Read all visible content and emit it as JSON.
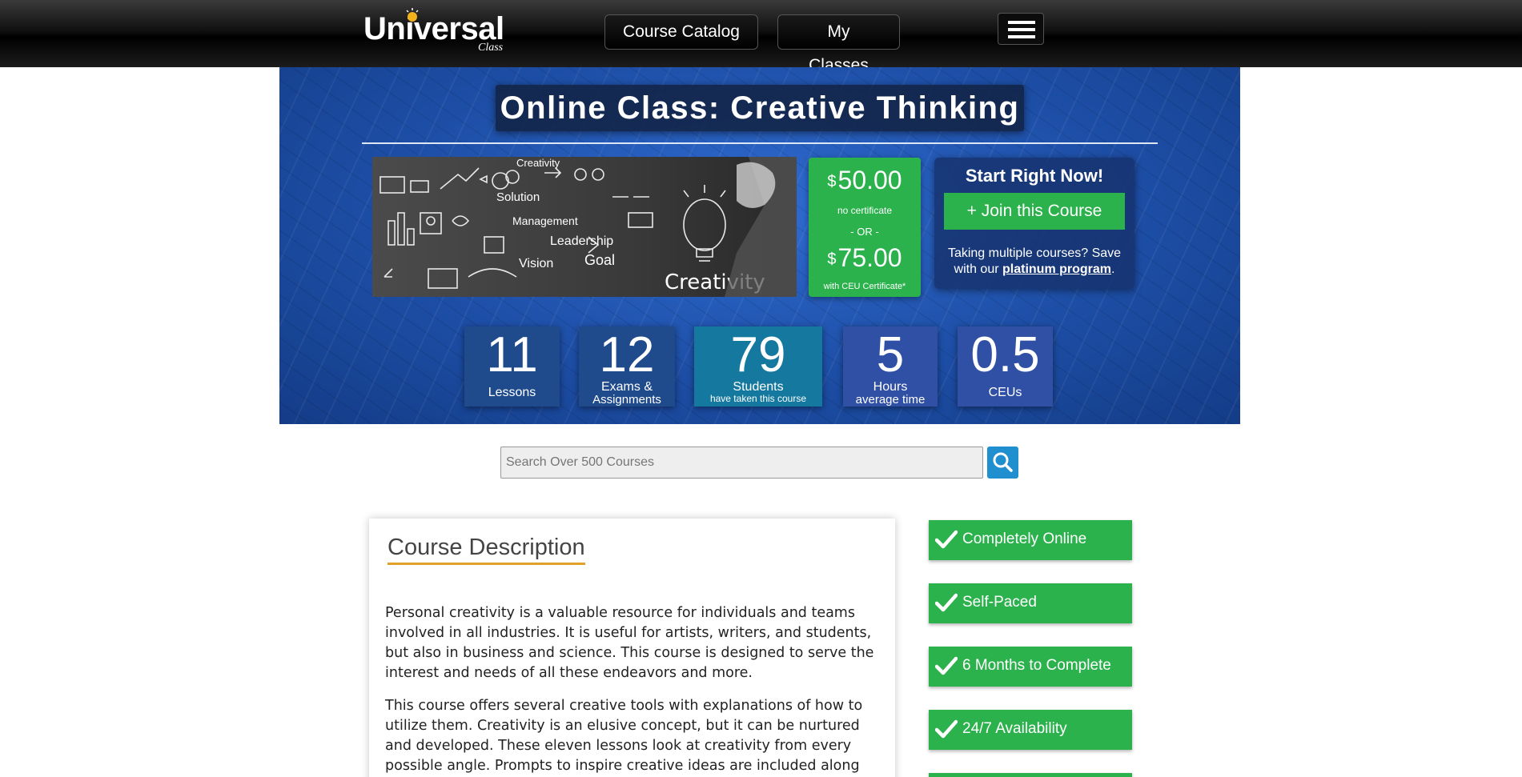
{
  "header": {
    "logo_main": "Universal",
    "logo_sub": "Class",
    "nav": [
      "Course Catalog",
      "My Classes"
    ],
    "menu_icon": "hamburger-menu-icon"
  },
  "hero": {
    "title": "Online Class: Creative Thinking",
    "image_words": [
      "Creativity",
      "Solution",
      "Management",
      "Leadership",
      "Vision",
      "Goal",
      "Creativity"
    ],
    "price": {
      "currency": "$",
      "first_amount": "50.00",
      "first_note": "no certificate",
      "or_label": "- OR -",
      "second_amount": "75.00",
      "second_note": "with CEU Certificate*"
    },
    "start": {
      "title": "Start Right Now!",
      "join_label": "+ Join this Course",
      "note_prefix": "Taking multiple courses? Save with our ",
      "note_link": "platinum program",
      "note_suffix": "."
    },
    "stats": [
      {
        "value": "11",
        "label": "Lessons",
        "sub": ""
      },
      {
        "value": "12",
        "label": "Exams &",
        "sub": "Assignments"
      },
      {
        "value": "79",
        "label": "Students",
        "sub": "have taken this course"
      },
      {
        "value": "5",
        "label": "Hours",
        "sub": "average time"
      },
      {
        "value": "0.5",
        "label": "CEUs",
        "sub": ""
      }
    ]
  },
  "search": {
    "placeholder": "Search Over 500 Courses",
    "icon": "search-icon"
  },
  "description": {
    "title": "Course Description",
    "paragraphs": [
      "Personal creativity is a valuable resource for individuals and teams involved in all industries. It is useful for artists, writers, and students, but also in business and science. This course is designed to serve the interest and needs of all these endeavors and more.",
      "This course offers several creative tools with explanations of how to utilize them. Creativity is an elusive concept, but it can be nurtured and developed. These eleven lessons look at creativity from every possible angle. Prompts to inspire creative ideas are included along"
    ]
  },
  "features": [
    "Completely Online",
    "Self-Paced",
    "6 Months to Complete",
    "24/7 Availability"
  ],
  "colors": {
    "green": "#2bb24c",
    "navy": "#1f4b8c",
    "teal": "#15799f",
    "hero_blue": "#1d4ea6",
    "accent_underline": "#e0a126"
  }
}
